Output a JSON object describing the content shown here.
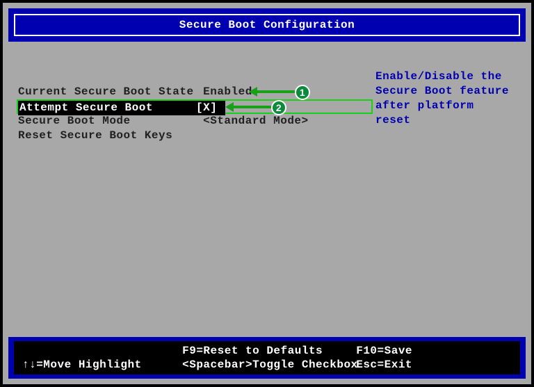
{
  "header": {
    "title": "Secure Boot Configuration"
  },
  "options": [
    {
      "label": "Current Secure Boot State",
      "value": "Enabled",
      "interact": "false"
    },
    {
      "label": "Attempt Secure Boot",
      "value": "[X]",
      "interact": "true"
    },
    {
      "label": "Secure Boot Mode",
      "value": "<Standard Mode>",
      "interact": "true"
    },
    {
      "label": "Reset Secure Boot Keys",
      "value": "",
      "interact": "true"
    }
  ],
  "selected_index": 1,
  "help": {
    "line1": "Enable/Disable the",
    "line2": "Secure Boot feature",
    "line3": "after platform reset"
  },
  "footer": {
    "top_center": "F9=Reset to Defaults",
    "top_right": "F10=Save",
    "bot_left": "↑↓=Move Highlight",
    "bot_center": "<Spacebar>Toggle Checkbox",
    "bot_right": "Esc=Exit"
  },
  "callouts": {
    "c1": "1",
    "c2": "2"
  }
}
